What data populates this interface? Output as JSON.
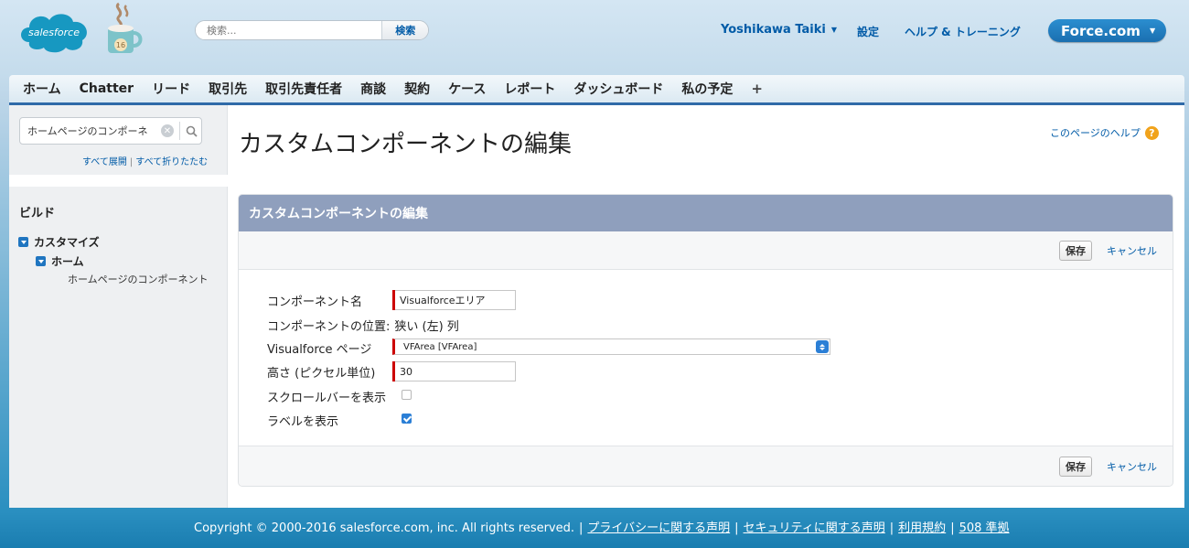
{
  "header": {
    "logo_text": "salesforce",
    "logo_badge": "16",
    "search_placeholder": "検索...",
    "search_button": "検索",
    "user_name": "Yoshikawa Taiki",
    "settings": "設定",
    "help_training": "ヘルプ & トレーニング",
    "app_switcher": "Force.com"
  },
  "tabs": [
    "ホーム",
    "Chatter",
    "リード",
    "取引先",
    "取引先責任者",
    "商談",
    "契約",
    "ケース",
    "レポート",
    "ダッシュボード",
    "私の予定"
  ],
  "tab_more": "+",
  "sidebar": {
    "search_value": "ホームページのコンポーネ",
    "expand_all": "すべて展開",
    "collapse_all": "すべて折りたたむ",
    "section": "ビルド",
    "tree": {
      "customize": "カスタマイズ",
      "home": "ホーム",
      "home_components": "ホームページのコンポーネント"
    }
  },
  "main": {
    "title": "カスタムコンポーネントの編集",
    "help_link": "このページのヘルプ",
    "panel_title": "カスタムコンポーネントの編集",
    "save": "保存",
    "cancel": "キャンセル",
    "fields": {
      "name_label": "コンポーネント名",
      "name_value": "Visualforceエリア",
      "position_label": "コンポーネントの位置:",
      "position_value": "狭い (左) 列",
      "vf_label": "Visualforce ページ",
      "vf_value": "VFArea [VFArea]",
      "height_label": "高さ (ピクセル単位)",
      "height_value": "30",
      "scrollbar_label": "スクロールバーを表示",
      "scrollbar_checked": false,
      "show_label_label": "ラベルを表示",
      "show_label_checked": true
    }
  },
  "footer": {
    "copyright": "Copyright © 2000-2016 salesforce.com, inc. All rights reserved.",
    "privacy": "プライバシーに関する声明",
    "security": "セキュリティに関する声明",
    "terms": "利用規約",
    "compliance": "508 準拠"
  }
}
